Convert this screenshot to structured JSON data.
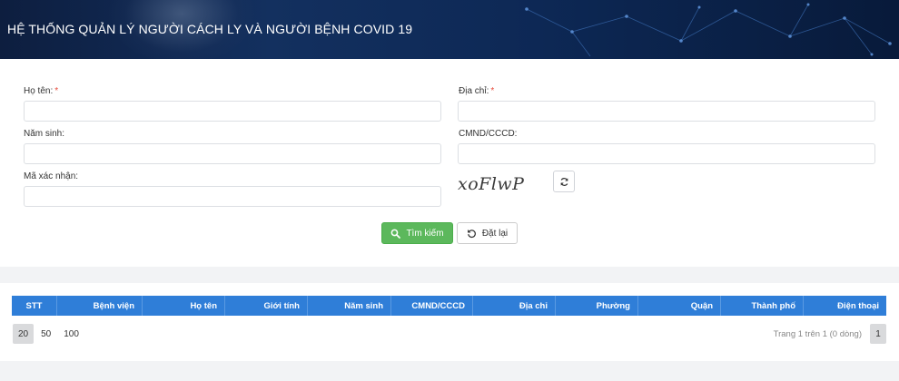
{
  "header": {
    "title": "HỆ THỐNG QUẢN LÝ NGƯỜI CÁCH LY VÀ NGƯỜI BỆNH COVID 19"
  },
  "form": {
    "fullname_label": "Họ tên:",
    "address_label": "Địa chỉ:",
    "birthyear_label": "Năm sinh:",
    "id_label": "CMND/CCCD:",
    "captcha_label": "Mã xác nhận:",
    "required_mark": "*",
    "fullname_value": "",
    "address_value": "",
    "birthyear_value": "",
    "id_value": "",
    "captcha_value": "",
    "captcha_text": "xoFlwP",
    "refresh_icon": "refresh-icon",
    "search_icon": "search-icon",
    "reset_icon": "undo-icon",
    "search_label": "Tìm kiếm",
    "reset_label": "Đặt lại",
    "search_color": "#5cb85c"
  },
  "table": {
    "header_color": "#2f7ed8",
    "columns": [
      "STT",
      "Bệnh viện",
      "Họ tên",
      "Giới tính",
      "Năm sinh",
      "CMND/CCCD",
      "Địa chỉ",
      "Phường",
      "Quận",
      "Thành phố",
      "Điện thoại"
    ],
    "page_sizes": [
      "20",
      "50",
      "100"
    ],
    "active_page_size": "20",
    "page_info": "Trang 1 trên 1 (0 dòng)",
    "current_page": "1"
  }
}
